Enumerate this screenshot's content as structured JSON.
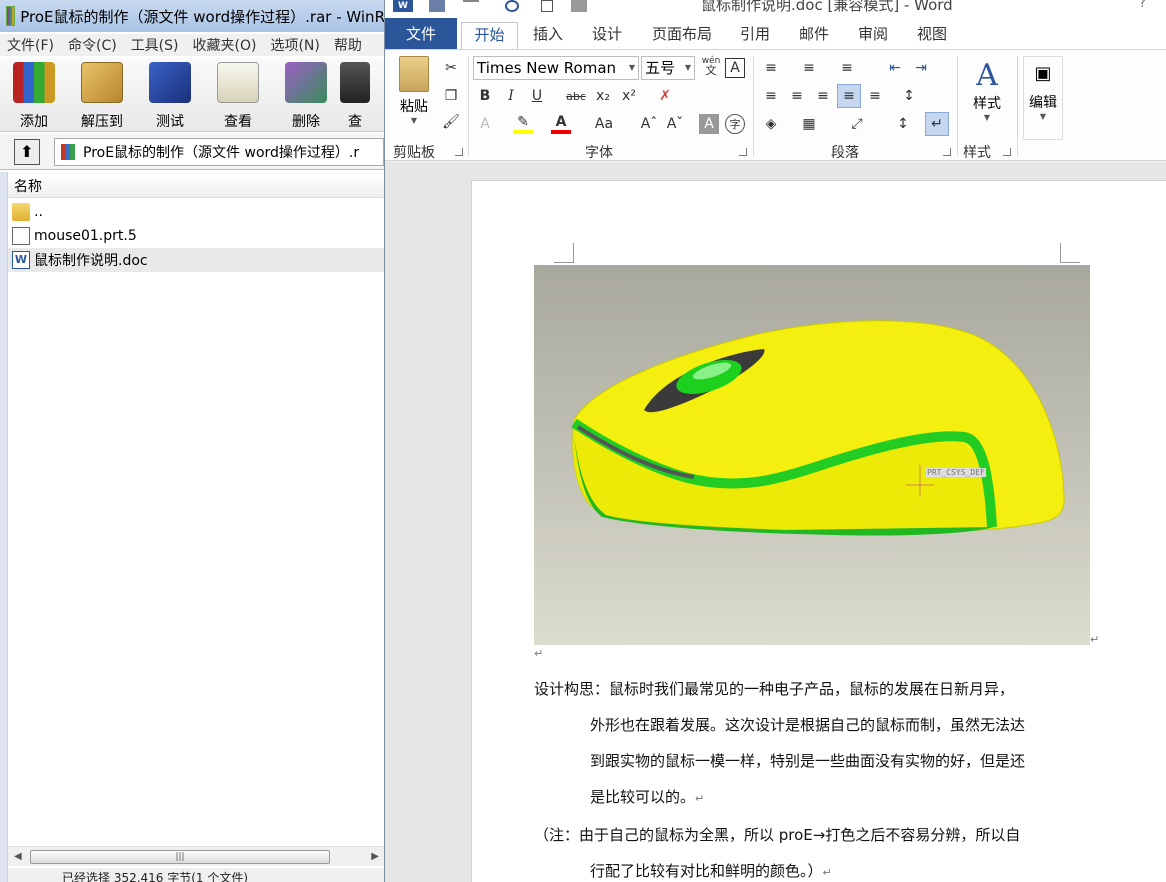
{
  "winrar": {
    "title": "ProE鼠标的制作（源文件 word操作过程）.rar - WinR",
    "menu": [
      "文件(F)",
      "命令(C)",
      "工具(S)",
      "收藏夹(O)",
      "选项(N)",
      "帮助"
    ],
    "toolbar": {
      "add": "添加",
      "extract": "解压到",
      "test": "测试",
      "view": "查看",
      "delete": "删除",
      "find": "查"
    },
    "path": "ProE鼠标的制作（源文件 word操作过程）.r",
    "column_name": "名称",
    "files": [
      {
        "name": ".."
      },
      {
        "name": "mouse01.prt.5"
      },
      {
        "name": "鼠标制作说明.doc"
      }
    ],
    "status": "已经选择 352,416 字节(1 个文件)"
  },
  "word": {
    "title": "鼠标制作说明.doc [兼容模式] - Word",
    "help": "?",
    "logo": "W",
    "tabs": {
      "file": "文件",
      "home": "开始",
      "insert": "插入",
      "design": "设计",
      "layout": "页面布局",
      "references": "引用",
      "mailings": "邮件",
      "review": "审阅",
      "view": "视图"
    },
    "ribbon": {
      "paste": "粘贴",
      "clipboard": "剪贴板",
      "font_name": "Times New Roman",
      "font_size": "五号",
      "wen": "wén",
      "wen2": "文",
      "boxA": "A",
      "bold": "B",
      "italic": "I",
      "underline": "U",
      "strike": "abc",
      "sub": "x₂",
      "sup": "x²",
      "aa": "Aa",
      "font_group": "字体",
      "paragraph_group": "段落",
      "styles": "样式",
      "styles_group": "样式",
      "editing": "编辑"
    },
    "figure_label": "PRT_CSYS_DEF",
    "paragraphs": {
      "p1_line1": "设计构思：鼠标时我们最常见的一种电子产品，鼠标的发展在日新月异，",
      "p1_line2": "外形也在跟着发展。这次设计是根据自己的鼠标而制，虽然无法达",
      "p1_line3": "到跟实物的鼠标一模一样，特别是一些曲面没有实物的好，但是还",
      "p1_line4": "是比较可以的。",
      "p2_line1": "（注：由于自己的鼠标为全黑，所以 proE→打色之后不容易分辨，所以自",
      "p2_line2": "行配了比较有对比和鲜明的颜色。）"
    },
    "para_mark": "↵"
  }
}
